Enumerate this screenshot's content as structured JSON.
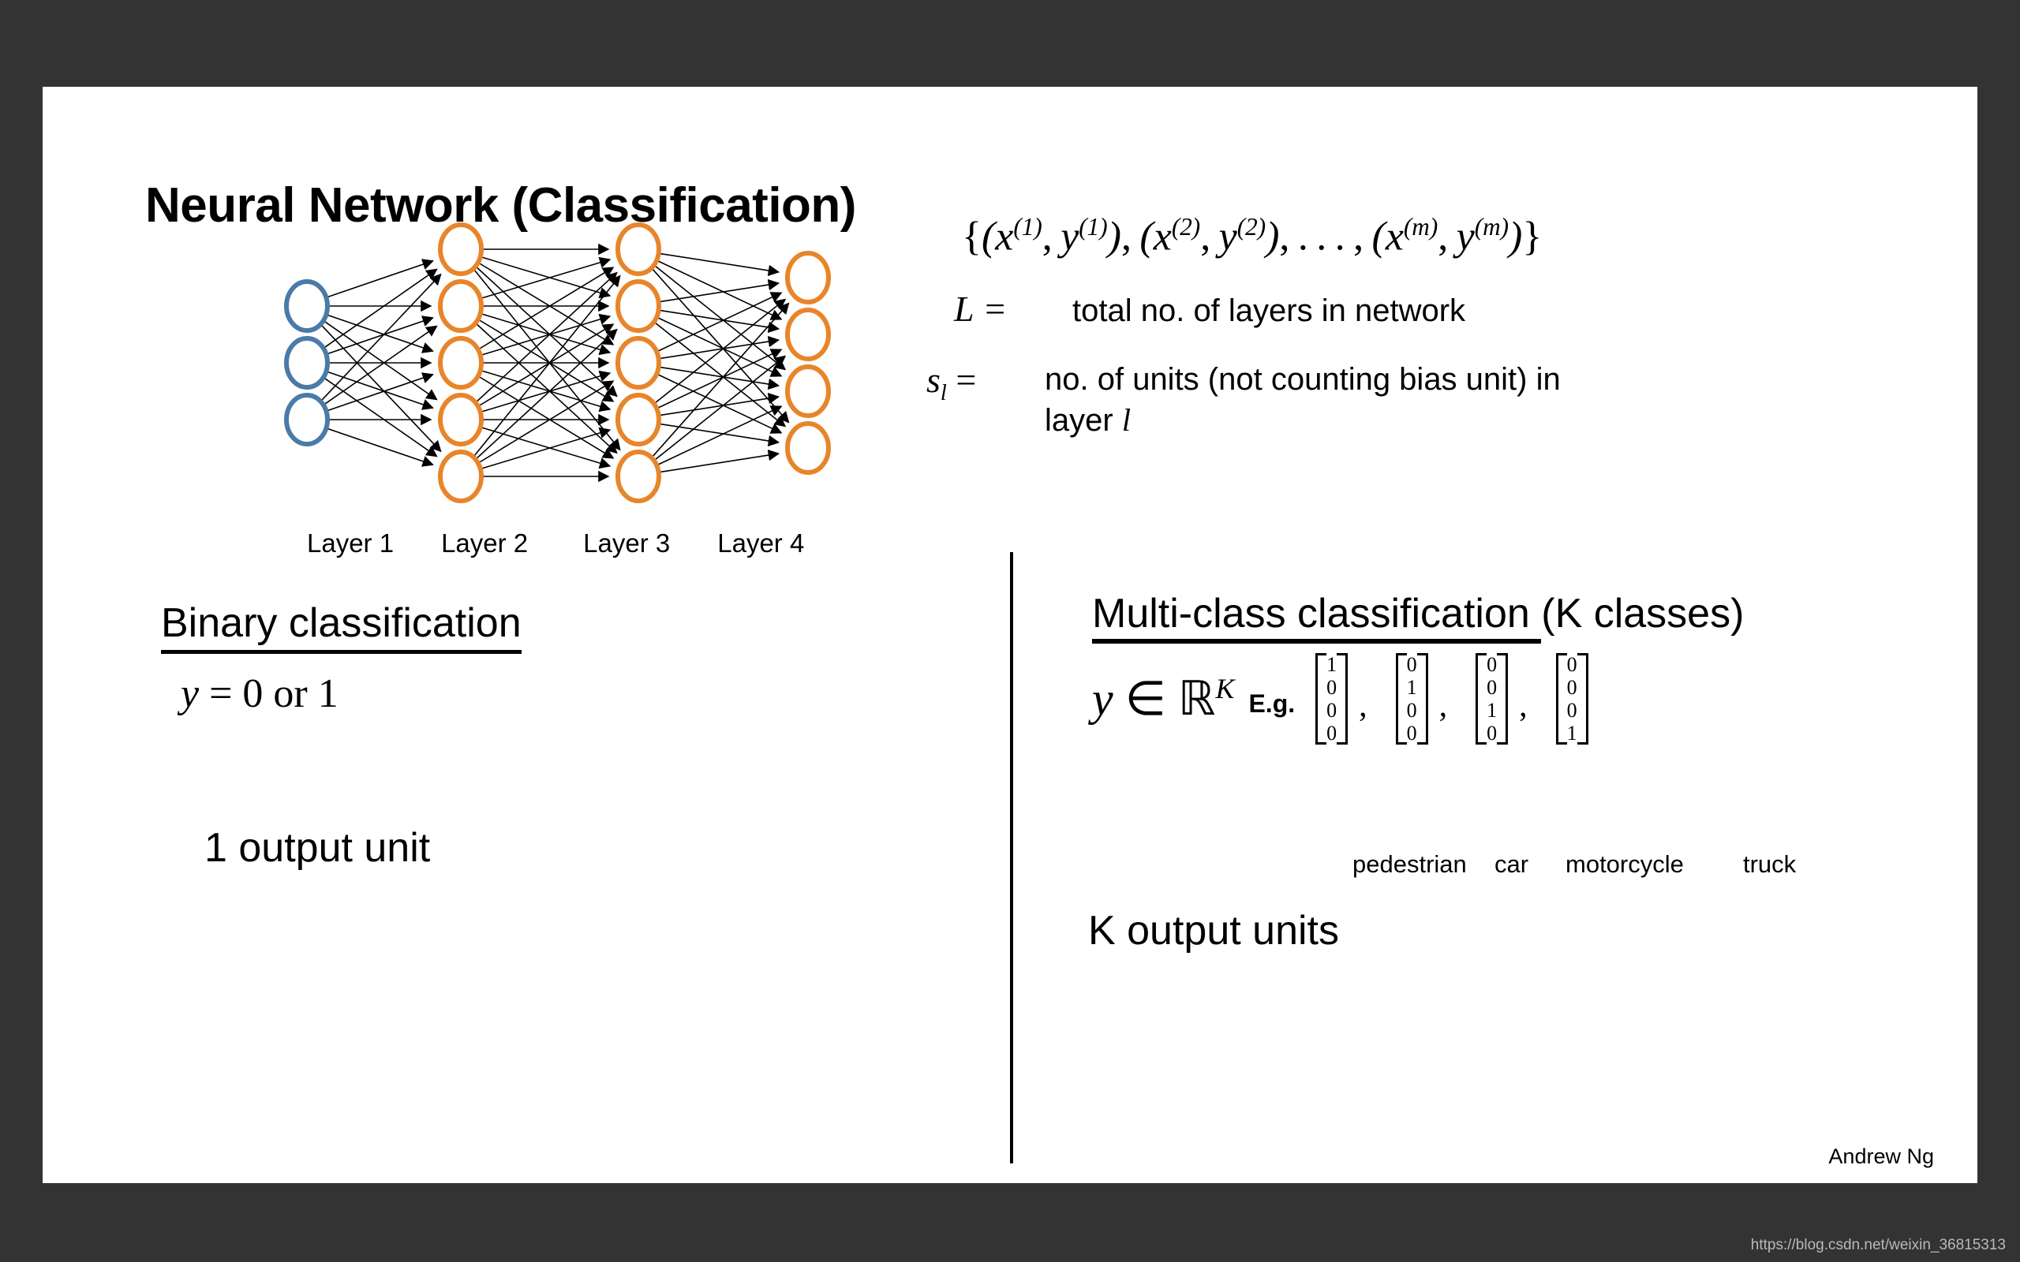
{
  "slide": {
    "title": "Neural Network (Classification)",
    "author": "Andrew Ng"
  },
  "watermark": {
    "url": "https://blog.csdn.net/weixin_36815313"
  },
  "network": {
    "layer_labels": [
      "Layer 1",
      "Layer 2",
      "Layer 3",
      "Layer 4"
    ],
    "layer_sizes": [
      3,
      5,
      5,
      4
    ],
    "input_node_color": "#4A7BA7",
    "hidden_node_color": "#E8852B",
    "edge_color": "#000000"
  },
  "definitions": {
    "training_set": "{(x⁽¹⁾, y⁽¹⁾), (x⁽²⁾, y⁽²⁾), . . . , (x⁽ᵐ⁾, y⁽ᵐ⁾)}",
    "L_symbol": "L =",
    "L_text": "total no. of layers in network",
    "s_symbol": "s",
    "s_subscript": "l",
    "s_equals": "=",
    "s_text_line1": "no. of units (not counting bias unit) in",
    "s_text_line2_prefix": "layer ",
    "s_text_line2_var": "l"
  },
  "binary": {
    "heading": "Binary classification",
    "equation_y": "y",
    "equation_rest": "= 0 or 1",
    "output_units": "1 output unit"
  },
  "multiclass": {
    "heading_underlined": "Multi-class classification ",
    "heading_rest": "(K classes)",
    "y_symbol": "y",
    "membership": "∈",
    "reals": "ℝ",
    "exponent": "K",
    "eg_label": "E.g.",
    "vectors": [
      [
        "1",
        "0",
        "0",
        "0"
      ],
      [
        "0",
        "1",
        "0",
        "0"
      ],
      [
        "0",
        "0",
        "1",
        "0"
      ],
      [
        "0",
        "0",
        "0",
        "1"
      ]
    ],
    "class_names": [
      "pedestrian",
      "car",
      "motorcycle",
      "truck"
    ],
    "output_units": "K output units"
  }
}
